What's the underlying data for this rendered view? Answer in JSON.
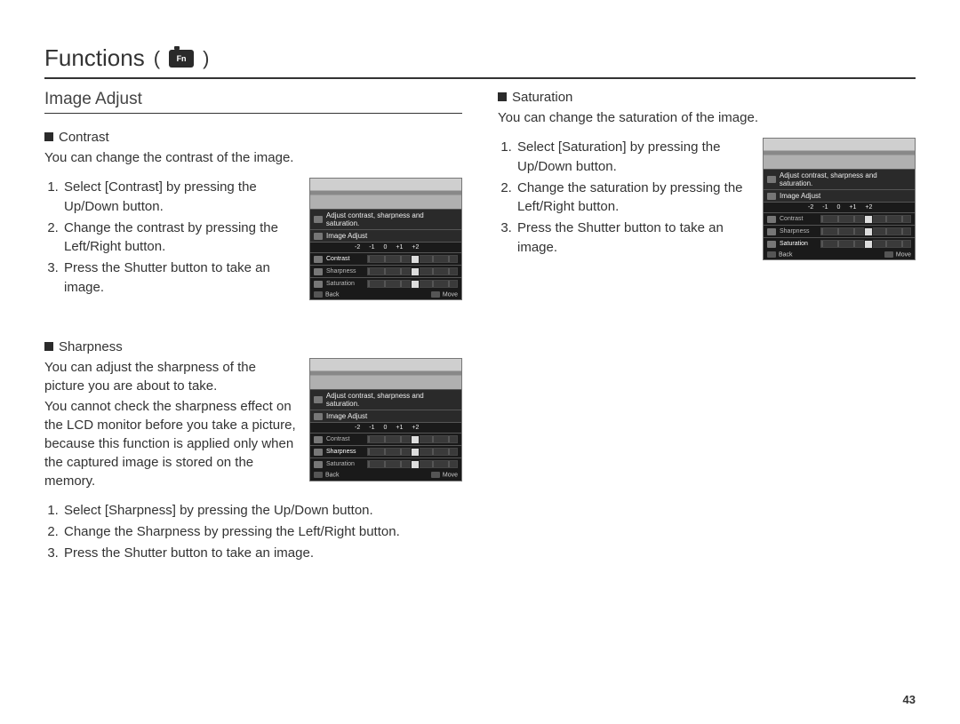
{
  "page": {
    "title": "Functions",
    "icon_label": "Fn",
    "number": "43"
  },
  "section": {
    "title": "Image Adjust"
  },
  "lcd_common": {
    "hint": "Adjust contrast, sharpness and saturation.",
    "sub": "Image Adjust",
    "scale": [
      "-2",
      "-1",
      "0",
      "+1",
      "+2"
    ],
    "rows": [
      "Contrast",
      "Sharpness",
      "Saturation"
    ],
    "back": "Back",
    "move": "Move"
  },
  "left": {
    "contrast": {
      "heading": "Contrast",
      "desc": "You can change the contrast of the image.",
      "steps": [
        "Select [Contrast] by pressing the Up/Down button.",
        "Change the contrast by pressing the Left/Right button.",
        "Press the Shutter button to take an image."
      ],
      "highlight_row": 0
    },
    "sharpness": {
      "heading": "Sharpness",
      "desc1": "You can adjust the sharpness of the picture you are about to take.",
      "desc2": "You cannot check the sharpness effect on the LCD monitor before you take a picture, because this function is applied only when the captured image is stored on the memory.",
      "steps": [
        "Select [Sharpness] by pressing the Up/Down button.",
        "Change the Sharpness by pressing the Left/Right button.",
        "Press the Shutter button to take an image."
      ],
      "highlight_row": 1
    }
  },
  "right": {
    "saturation": {
      "heading": "Saturation",
      "desc": "You can change the saturation of the image.",
      "steps": [
        "Select [Saturation] by pressing the Up/Down button.",
        "Change the saturation by pressing the Left/Right button.",
        "Press the Shutter button to take an image."
      ],
      "highlight_row": 2
    }
  }
}
